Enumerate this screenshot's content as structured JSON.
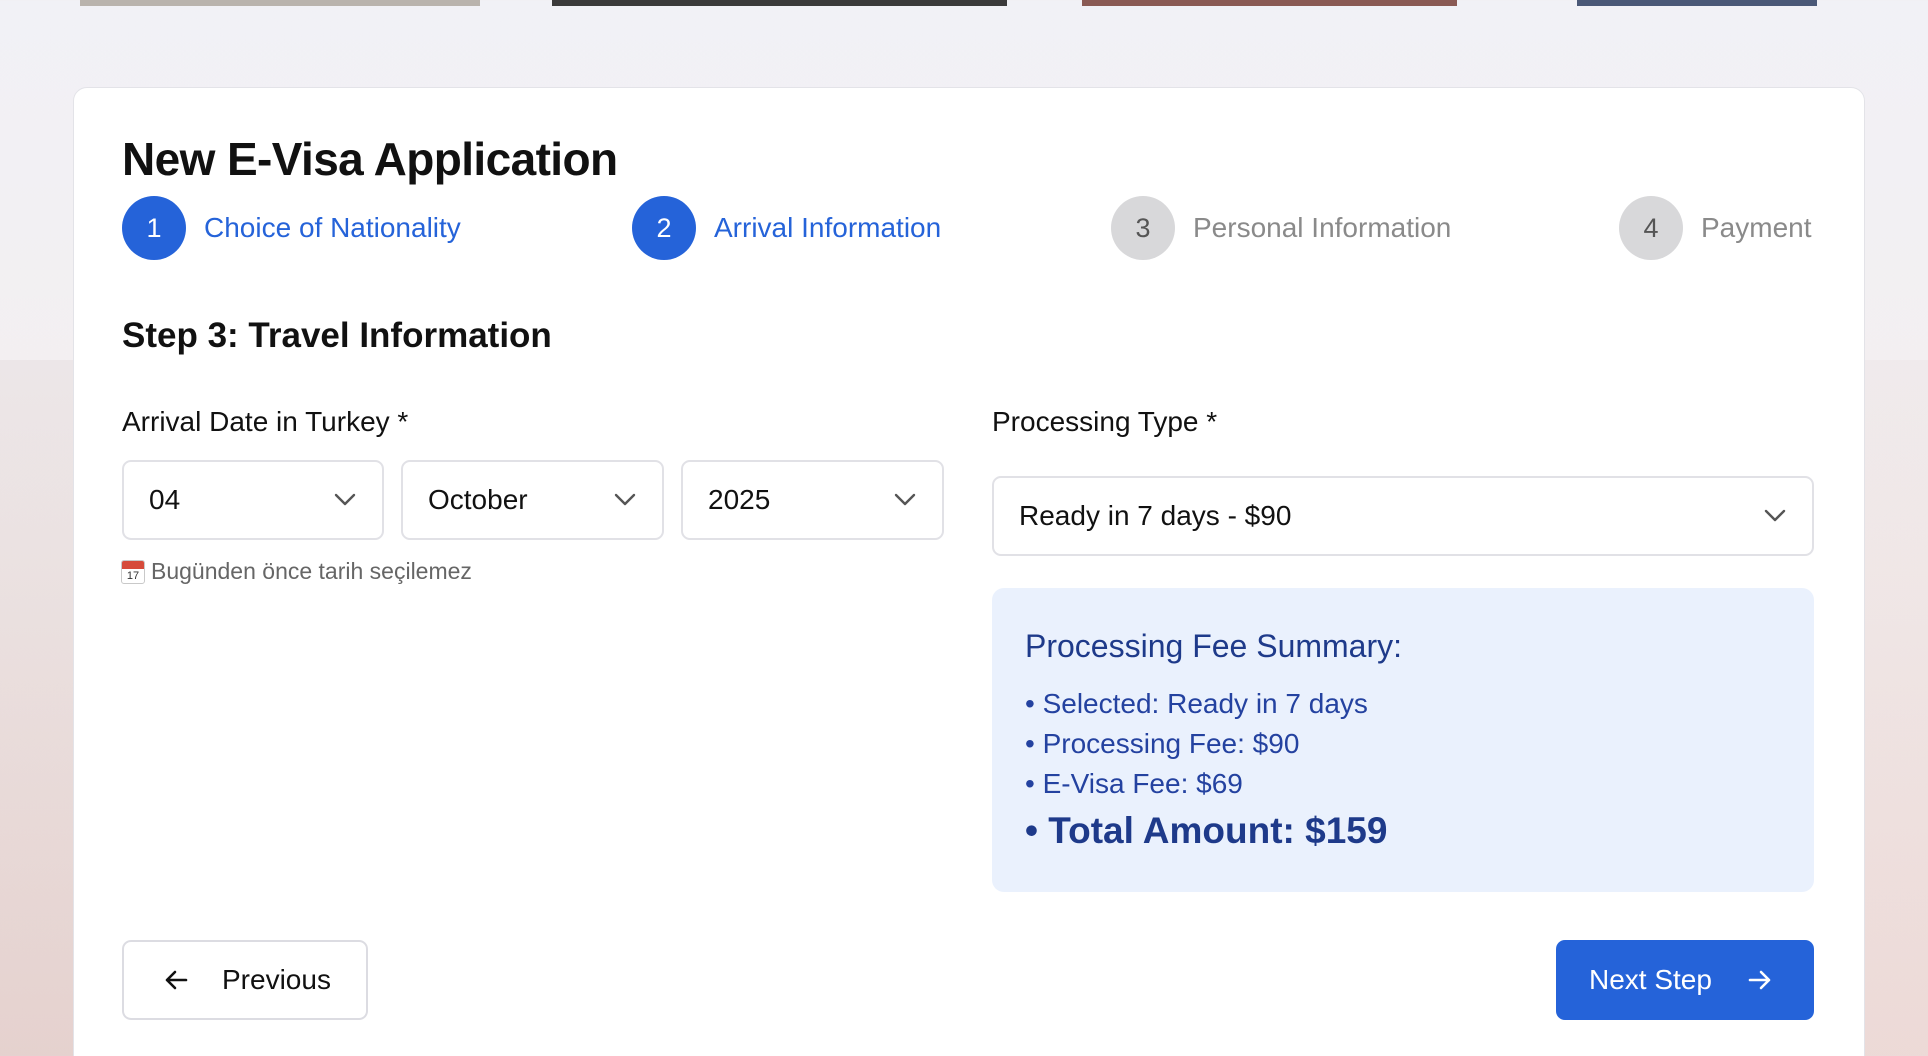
{
  "page": {
    "title": "New E-Visa Application"
  },
  "stepper": [
    {
      "number": "1",
      "label": "Choice of Nationality",
      "state": "active"
    },
    {
      "number": "2",
      "label": "Arrival Information",
      "state": "active"
    },
    {
      "number": "3",
      "label": "Personal Information",
      "state": "inactive"
    },
    {
      "number": "4",
      "label": "Payment",
      "state": "inactive"
    }
  ],
  "section": {
    "title": "Step 3: Travel Information"
  },
  "arrival_date": {
    "label": "Arrival Date in Turkey *",
    "day": "04",
    "month": "October",
    "year": "2025",
    "hint": "Bugünden önce tarih seçilemez",
    "hint_icon": "calendar-icon",
    "hint_icon_text": "17"
  },
  "processing": {
    "label": "Processing Type *",
    "selected": "Ready in 7 days - $90"
  },
  "summary": {
    "title": "Processing Fee Summary:",
    "lines": [
      "• Selected: Ready in 7 days",
      "• Processing Fee: $90",
      "• E-Visa Fee: $69"
    ],
    "total": "• Total Amount: $159"
  },
  "buttons": {
    "previous": "Previous",
    "next": "Next Step"
  },
  "colors": {
    "accent": "#2563d9",
    "summary_bg": "#eaf1fd",
    "summary_text": "#1e3a8a",
    "inactive_step": "#d8d8da"
  }
}
